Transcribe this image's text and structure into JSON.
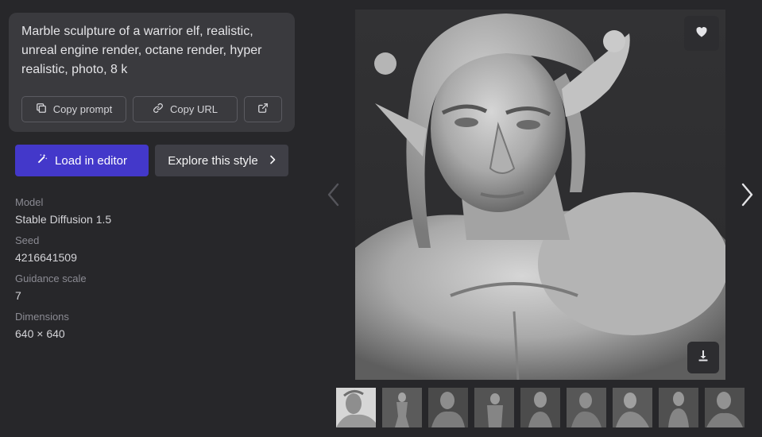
{
  "prompt": {
    "text": "Marble sculpture of a warrior elf, realistic, unreal engine render, octane render, hyper realistic, photo, 8 k",
    "copy_prompt_label": "Copy prompt",
    "copy_url_label": "Copy URL"
  },
  "actions": {
    "load_editor_label": "Load in editor",
    "explore_style_label": "Explore this style"
  },
  "details": {
    "model_label": "Model",
    "model_value": "Stable Diffusion 1.5",
    "seed_label": "Seed",
    "seed_value": "4216641509",
    "guidance_label": "Guidance scale",
    "guidance_value": "7",
    "dimensions_label": "Dimensions",
    "dimensions_value": "640 × 640"
  },
  "icons": {
    "copy": "copy-icon",
    "link": "link-icon",
    "external": "external-link-icon",
    "wand": "magic-wand-icon",
    "chevron": "chevron-right-icon",
    "heart": "heart-icon",
    "download": "download-icon"
  },
  "colors": {
    "accent": "#4338ca",
    "background": "#27272a",
    "card": "#3a3a3e"
  },
  "thumbnails": [
    "thumb-1",
    "thumb-2",
    "thumb-3",
    "thumb-4",
    "thumb-5",
    "thumb-6",
    "thumb-7",
    "thumb-8",
    "thumb-9"
  ]
}
